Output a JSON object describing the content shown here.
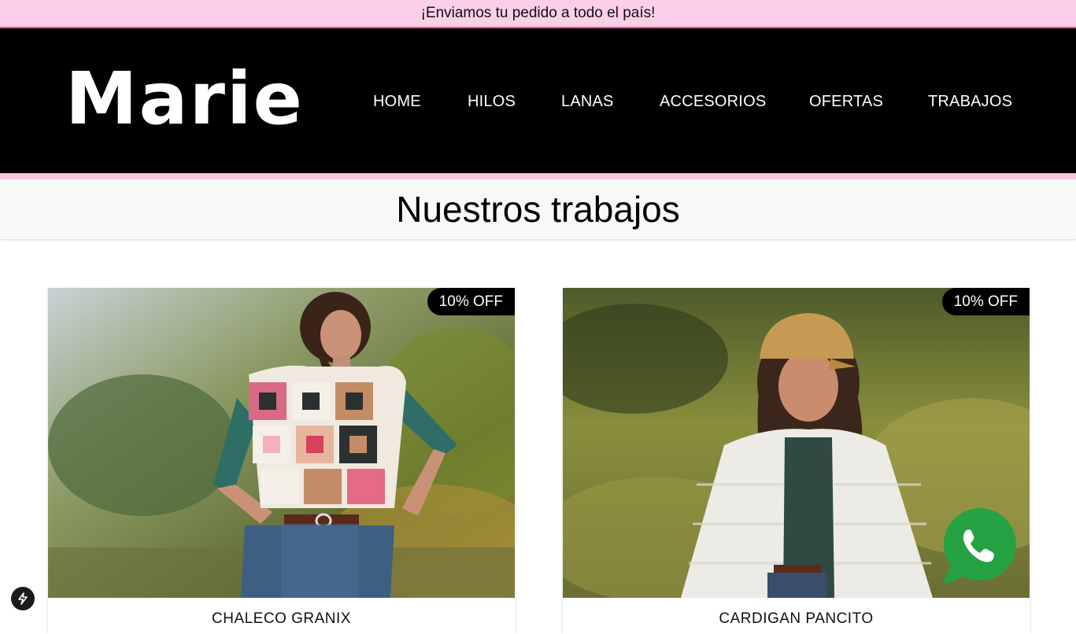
{
  "announcement": "¡Enviamos tu pedido a todo el país!",
  "brand": {
    "logo_text": "Marie"
  },
  "nav": {
    "items": [
      "HOME",
      "HILOS",
      "LANAS",
      "ACCESORIOS",
      "OFERTAS",
      "TRABAJOS"
    ]
  },
  "page_title": "Nuestros trabajos",
  "products": [
    {
      "name": "CHALECO GRANIX",
      "badge": "10% OFF"
    },
    {
      "name": "CARDIGAN PANCITO",
      "badge": "10% OFF"
    }
  ],
  "icons": {
    "whatsapp": "whatsapp-icon",
    "bolt": "lightning-icon"
  },
  "colors": {
    "announcement_bg": "#fccfe8",
    "header_bg": "#000000",
    "accent_pink": "#e7578f",
    "whatsapp_green": "#25a244"
  }
}
